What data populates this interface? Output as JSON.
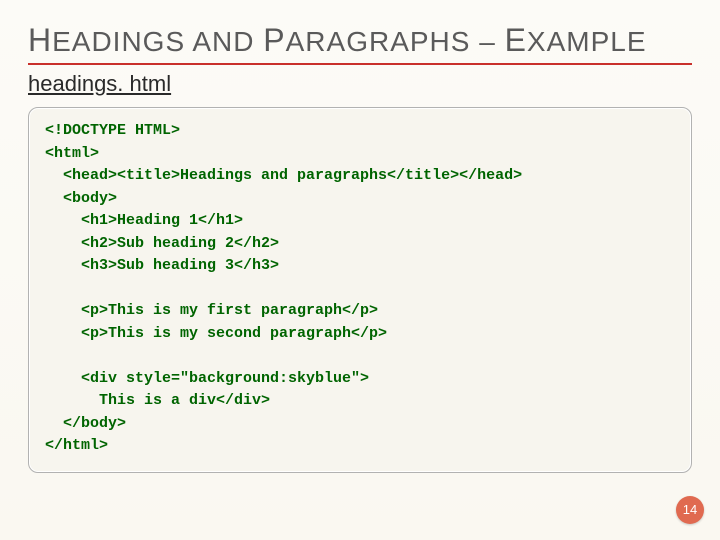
{
  "title": {
    "h": "H",
    "eadings": "EADINGS AND ",
    "p": "P",
    "aragraphs": "ARAGRAPHS – ",
    "e": "E",
    "xample": "XAMPLE"
  },
  "filename": "headings. html",
  "code": {
    "l1": "<!DOCTYPE HTML>",
    "l2": "<html>",
    "l3": "  <head><title>Headings and paragraphs</title></head>",
    "l4": "  <body>",
    "l5": "    <h1>Heading 1</h1>",
    "l6": "    <h2>Sub heading 2</h2>",
    "l7": "    <h3>Sub heading 3</h3>",
    "blank1": "",
    "l8": "    <p>This is my first paragraph</p>",
    "l9": "    <p>This is my second paragraph</p>",
    "blank2": "",
    "l10": "    <div style=\"background:skyblue\">",
    "l11": "      This is a div</div>",
    "l12": "  </body>",
    "l13": "</html>"
  },
  "page_number": "14"
}
